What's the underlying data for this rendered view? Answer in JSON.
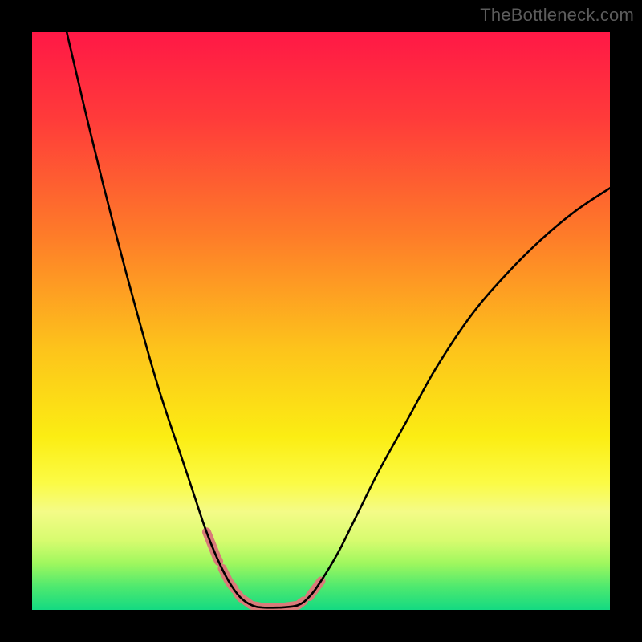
{
  "watermark": "TheBottleneck.com",
  "chart_data": {
    "type": "line",
    "title": "",
    "xlabel": "",
    "ylabel": "",
    "xlim": [
      0,
      100
    ],
    "ylim": [
      0,
      100
    ],
    "background_gradient_stops": [
      {
        "offset": 0.0,
        "color": "#ff1846"
      },
      {
        "offset": 0.15,
        "color": "#ff3b3a"
      },
      {
        "offset": 0.35,
        "color": "#fe7b29"
      },
      {
        "offset": 0.55,
        "color": "#fdc41b"
      },
      {
        "offset": 0.7,
        "color": "#fbed13"
      },
      {
        "offset": 0.78,
        "color": "#fbfb45"
      },
      {
        "offset": 0.83,
        "color": "#f4fb87"
      },
      {
        "offset": 0.88,
        "color": "#d7fb6f"
      },
      {
        "offset": 0.92,
        "color": "#9ef75e"
      },
      {
        "offset": 0.96,
        "color": "#4ee96f"
      },
      {
        "offset": 1.0,
        "color": "#14da82"
      }
    ],
    "series": [
      {
        "name": "left-curve",
        "stroke": "#000000",
        "points": [
          {
            "x": 6,
            "y": 100
          },
          {
            "x": 10,
            "y": 83
          },
          {
            "x": 14,
            "y": 67
          },
          {
            "x": 18,
            "y": 52
          },
          {
            "x": 22,
            "y": 38
          },
          {
            "x": 26,
            "y": 26
          },
          {
            "x": 28,
            "y": 20
          },
          {
            "x": 30,
            "y": 14
          },
          {
            "x": 32,
            "y": 9
          },
          {
            "x": 34,
            "y": 5
          },
          {
            "x": 36,
            "y": 2.2
          },
          {
            "x": 38,
            "y": 0.8
          },
          {
            "x": 40,
            "y": 0.4
          },
          {
            "x": 43,
            "y": 0.4
          }
        ]
      },
      {
        "name": "right-curve",
        "stroke": "#000000",
        "points": [
          {
            "x": 43,
            "y": 0.4
          },
          {
            "x": 46,
            "y": 0.8
          },
          {
            "x": 48,
            "y": 2.3
          },
          {
            "x": 50,
            "y": 5
          },
          {
            "x": 53,
            "y": 10
          },
          {
            "x": 56,
            "y": 16
          },
          {
            "x": 60,
            "y": 24
          },
          {
            "x": 65,
            "y": 33
          },
          {
            "x": 70,
            "y": 42
          },
          {
            "x": 76,
            "y": 51
          },
          {
            "x": 82,
            "y": 58
          },
          {
            "x": 88,
            "y": 64
          },
          {
            "x": 94,
            "y": 69
          },
          {
            "x": 100,
            "y": 73
          }
        ]
      }
    ],
    "highlight_segments": [
      {
        "series": "left-curve",
        "x_range": [
          30.2,
          32.3
        ],
        "color": "#d97a79",
        "width": 11
      },
      {
        "series": "left-curve",
        "x_range": [
          32.9,
          35.0
        ],
        "color": "#d97a79",
        "width": 11
      },
      {
        "series": "left-curve",
        "x_range": [
          35.5,
          43.0
        ],
        "color": "#d97a79",
        "width": 11
      },
      {
        "series": "right-curve",
        "x_range": [
          43.0,
          47.0
        ],
        "color": "#d97a79",
        "width": 11
      },
      {
        "series": "right-curve",
        "x_range": [
          48.0,
          50.0
        ],
        "color": "#d97a79",
        "width": 11
      }
    ]
  }
}
